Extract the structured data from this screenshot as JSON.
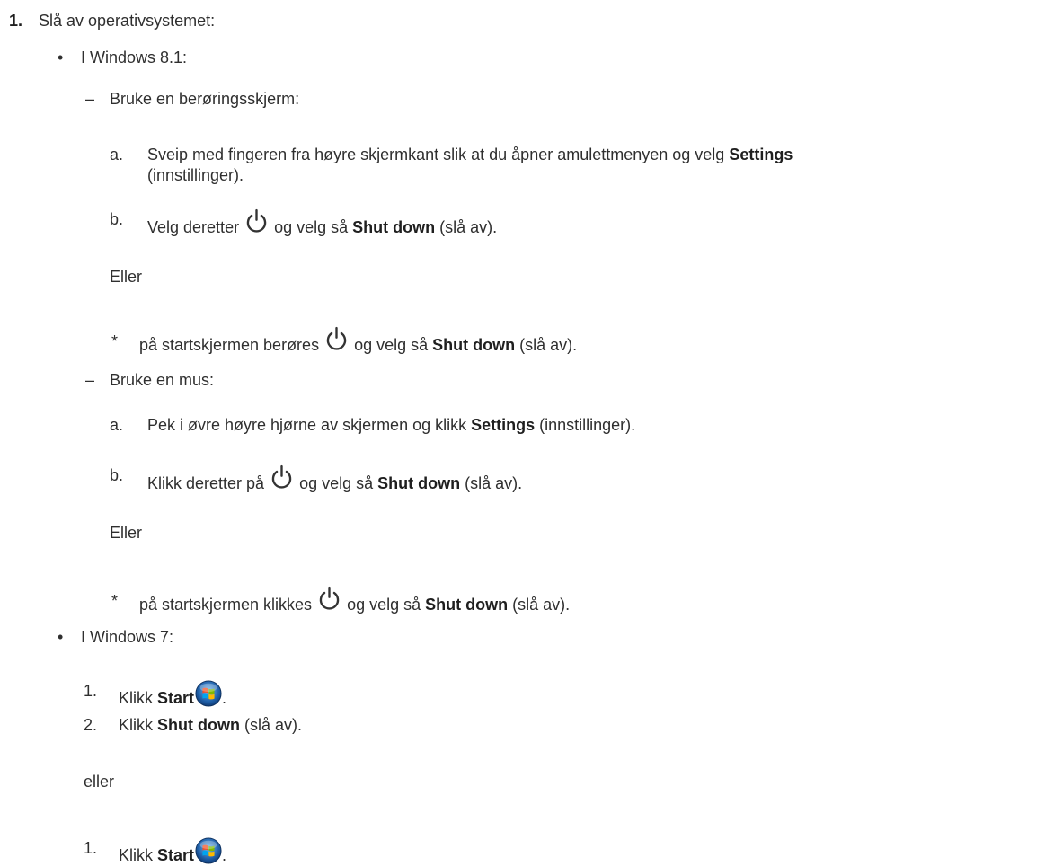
{
  "intro": {
    "marker": "1.",
    "text": "Slå av operativsystemet:"
  },
  "win81": {
    "marker": "•",
    "label": "I Windows 8.1:",
    "touch": {
      "marker": "–",
      "label": "Bruke en berøringsskjerm:",
      "a": {
        "marker": "a.",
        "pre": "Sveip med fingeren fra høyre skjermkant slik at du åpner amulettmenyen og velg ",
        "bold": "Settings",
        "cont": "(innstillinger)."
      },
      "b": {
        "marker": "b.",
        "pre": "Velg deretter",
        "mid": "og velg så ",
        "bold": "Shut down",
        "post": " (slå av)."
      },
      "or": "Eller",
      "star": {
        "marker": "*",
        "pre": "på startskjermen berøres",
        "mid": "og velg så ",
        "bold": "Shut down",
        "post": " (slå av)."
      }
    },
    "mouse": {
      "marker": "–",
      "label": "Bruke en mus:",
      "a": {
        "marker": "a.",
        "pre": "Pek i øvre høyre hjørne av skjermen og klikk ",
        "bold": "Settings",
        "post": " (innstillinger)."
      },
      "b": {
        "marker": "b.",
        "pre": "Klikk deretter på",
        "mid": "og velg så ",
        "bold": "Shut down",
        "post": " (slå av)."
      },
      "or": "Eller",
      "star": {
        "marker": "*",
        "pre": "på startskjermen klikkes",
        "mid": "og velg så ",
        "bold": "Shut down",
        "post": " (slå av)."
      }
    }
  },
  "win7": {
    "marker": "•",
    "label": "I Windows 7:",
    "steps1": [
      {
        "marker": "1.",
        "pre": "Klikk ",
        "bold": "Start",
        "post": "."
      },
      {
        "marker": "2.",
        "pre": "Klikk ",
        "bold": "Shut down",
        "post": " (slå av)."
      }
    ],
    "or": "eller",
    "steps2": [
      {
        "marker": "1.",
        "pre": "Klikk ",
        "bold": "Start",
        "post": "."
      }
    ]
  },
  "icons": {
    "power": "power-icon",
    "start": "windows-start-orb-icon"
  }
}
